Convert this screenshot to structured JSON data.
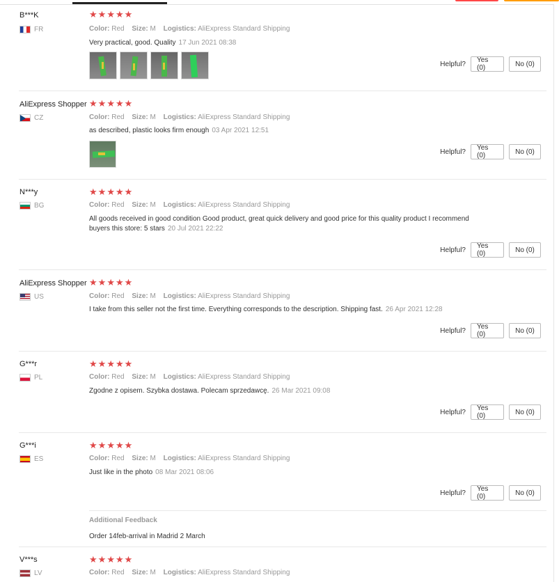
{
  "labels": {
    "color": "Color:",
    "size": "Size:",
    "logistics": "Logistics:",
    "helpful": "Helpful?",
    "yes": "Yes (0)",
    "no": "No (0)",
    "additional_feedback": "Additional Feedback"
  },
  "colors": {
    "star": "#e04848",
    "accent_red": "#ff4747",
    "accent_orange": "#ff9c00"
  },
  "reviews": [
    {
      "user": "B***K",
      "country": "FR",
      "flag": "fr-flag-icon",
      "rating": 5,
      "color": "Red",
      "size": "M",
      "logistics": "AliExpress Standard Shipping",
      "text": "Very practical, good. Quality",
      "time": "17 Jun 2021 08:38",
      "photos": 4
    },
    {
      "user": "AliExpress Shopper",
      "country": "CZ",
      "flag": "cz-flag-icon",
      "rating": 5,
      "color": "Red",
      "size": "M",
      "logistics": "AliExpress Standard Shipping",
      "text": "as described, plastic looks firm enough",
      "time": "03 Apr 2021 12:51",
      "photos": 1
    },
    {
      "user": "N***y",
      "country": "BG",
      "flag": "bg-flag-icon",
      "rating": 5,
      "color": "Red",
      "size": "M",
      "logistics": "AliExpress Standard Shipping",
      "text": "All goods received in good condition Good product, great quick delivery and good price for this quality product I recommend buyers this store: 5 stars",
      "time": "20 Jul 2021 22:22",
      "photos": 0
    },
    {
      "user": "AliExpress Shopper",
      "country": "US",
      "flag": "us-flag-icon",
      "rating": 5,
      "color": "Red",
      "size": "M",
      "logistics": "AliExpress Standard Shipping",
      "text": "I take from this seller not the first time. Everything corresponds to the description. Shipping fast.",
      "time": "26 Apr 2021 12:28",
      "photos": 0
    },
    {
      "user": "G***r",
      "country": "PL",
      "flag": "pl-flag-icon",
      "rating": 5,
      "color": "Red",
      "size": "M",
      "logistics": "AliExpress Standard Shipping",
      "text": "Zgodne z opisem. Szybka dostawa. Polecam sprzedawcę.",
      "time": "26 Mar 2021 09:08",
      "photos": 0
    },
    {
      "user": "G***i",
      "country": "ES",
      "flag": "es-flag-icon",
      "rating": 5,
      "color": "Red",
      "size": "M",
      "logistics": "AliExpress Standard Shipping",
      "text": "Just like in the photo",
      "time": "08 Mar 2021 08:06",
      "photos": 0,
      "additional_feedback": "Order 14feb-arrival in Madrid 2 March"
    },
    {
      "user": "V***s",
      "country": "LV",
      "flag": "lv-flag-icon",
      "rating": 5,
      "color": "Red",
      "size": "M",
      "logistics": "AliExpress Standard Shipping"
    }
  ]
}
